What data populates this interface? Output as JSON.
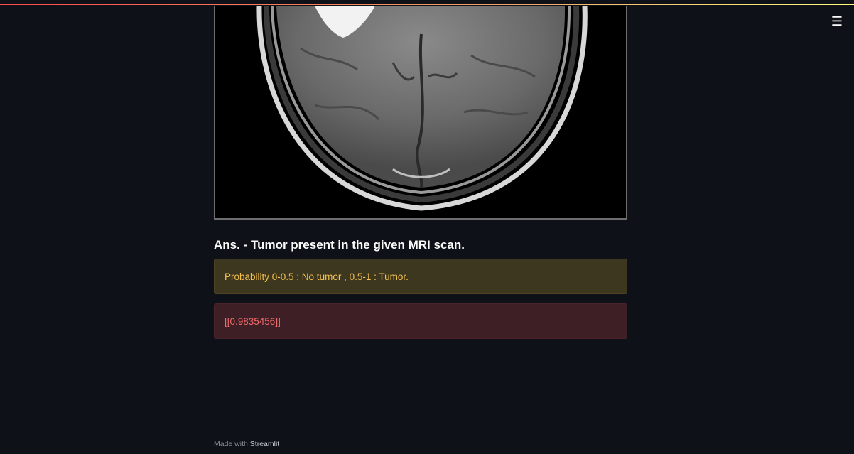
{
  "header": {
    "menu_icon": "hamburger-icon",
    "menu_glyph": "☰"
  },
  "image": {
    "alt": "MRI scan"
  },
  "result": {
    "answer": "Ans. - Tumor present in the given MRI scan.",
    "warning": "Probability 0-0.5 : No tumor , 0.5-1 : Tumor.",
    "probability": "[[0.9835456]]"
  },
  "footer": {
    "made_with": "Made with",
    "brand": "Streamlit"
  },
  "colors": {
    "background": "#0e1117",
    "warning_text": "#f2c14e",
    "error_text": "#f26b6b"
  }
}
